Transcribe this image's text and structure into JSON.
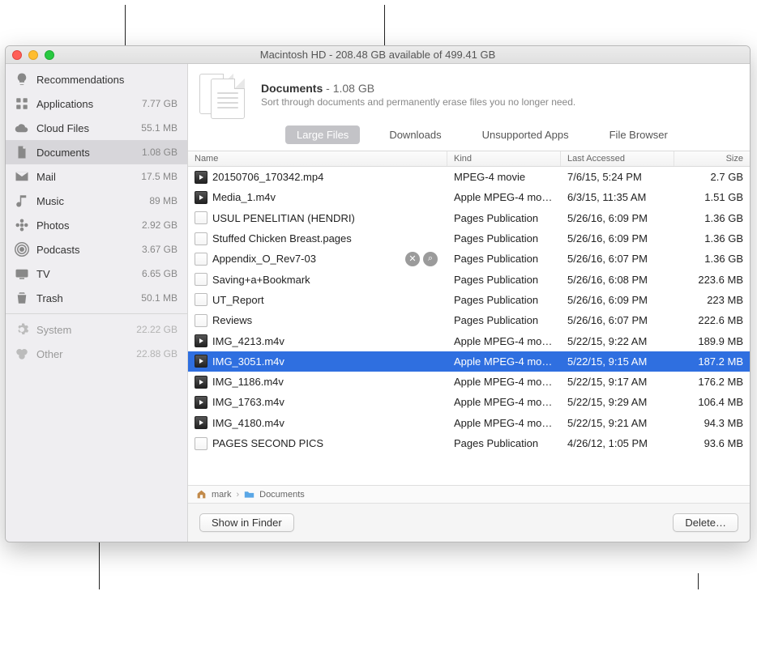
{
  "window": {
    "title": "Macintosh HD - 208.48 GB available of 499.41 GB"
  },
  "sidebar": {
    "items": [
      {
        "label": "Recommendations",
        "size": "",
        "icon": "lightbulb",
        "dim": false,
        "selected": false
      },
      {
        "label": "Applications",
        "size": "7.77 GB",
        "icon": "app-grid",
        "dim": false,
        "selected": false
      },
      {
        "label": "Cloud Files",
        "size": "55.1 MB",
        "icon": "cloud",
        "dim": false,
        "selected": false
      },
      {
        "label": "Documents",
        "size": "1.08 GB",
        "icon": "document",
        "dim": false,
        "selected": true
      },
      {
        "label": "Mail",
        "size": "17.5 MB",
        "icon": "envelope",
        "dim": false,
        "selected": false
      },
      {
        "label": "Music",
        "size": "89 MB",
        "icon": "music-note",
        "dim": false,
        "selected": false
      },
      {
        "label": "Photos",
        "size": "2.92 GB",
        "icon": "flower",
        "dim": false,
        "selected": false
      },
      {
        "label": "Podcasts",
        "size": "3.67 GB",
        "icon": "podcast",
        "dim": false,
        "selected": false
      },
      {
        "label": "TV",
        "size": "6.65 GB",
        "icon": "tv",
        "dim": false,
        "selected": false
      },
      {
        "label": "Trash",
        "size": "50.1 MB",
        "icon": "trash",
        "dim": false,
        "selected": false
      },
      {
        "label": "System",
        "size": "22.22 GB",
        "icon": "gear",
        "dim": true,
        "selected": false,
        "sepBefore": true
      },
      {
        "label": "Other",
        "size": "22.88 GB",
        "icon": "circles",
        "dim": true,
        "selected": false
      }
    ]
  },
  "header": {
    "title": "Documents",
    "size": "1.08 GB",
    "separator": " - ",
    "description": "Sort through documents and permanently erase files you no longer need."
  },
  "tabs": [
    {
      "label": "Large Files",
      "active": true
    },
    {
      "label": "Downloads",
      "active": false
    },
    {
      "label": "Unsupported Apps",
      "active": false
    },
    {
      "label": "File Browser",
      "active": false
    }
  ],
  "columns": {
    "name": "Name",
    "kind": "Kind",
    "date": "Last Accessed",
    "size": "Size"
  },
  "rows": [
    {
      "name": "20150706_170342.mp4",
      "kind": "MPEG-4 movie",
      "date": "7/6/15, 5:24 PM",
      "size": "2.7 GB",
      "thumb": "video"
    },
    {
      "name": "Media_1.m4v",
      "kind": "Apple MPEG-4 mo…",
      "date": "6/3/15, 11:35 AM",
      "size": "1.51 GB",
      "thumb": "video"
    },
    {
      "name": "USUL PENELITIAN (HENDRI)",
      "kind": "Pages Publication",
      "date": "5/26/16, 6:09 PM",
      "size": "1.36 GB",
      "thumb": "pages"
    },
    {
      "name": "Stuffed Chicken Breast.pages",
      "kind": "Pages Publication",
      "date": "5/26/16, 6:09 PM",
      "size": "1.36 GB",
      "thumb": "pages"
    },
    {
      "name": "Appendix_O_Rev7-03",
      "kind": "Pages Publication",
      "date": "5/26/16, 6:07 PM",
      "size": "1.36 GB",
      "thumb": "pages",
      "hover": true
    },
    {
      "name": "Saving+a+Bookmark",
      "kind": "Pages Publication",
      "date": "5/26/16, 6:08 PM",
      "size": "223.6 MB",
      "thumb": "pages"
    },
    {
      "name": "UT_Report",
      "kind": "Pages Publication",
      "date": "5/26/16, 6:09 PM",
      "size": "223 MB",
      "thumb": "pages"
    },
    {
      "name": "Reviews",
      "kind": "Pages Publication",
      "date": "5/26/16, 6:07 PM",
      "size": "222.6 MB",
      "thumb": "pages"
    },
    {
      "name": "IMG_4213.m4v",
      "kind": "Apple MPEG-4 mo…",
      "date": "5/22/15, 9:22 AM",
      "size": "189.9 MB",
      "thumb": "video"
    },
    {
      "name": "IMG_3051.m4v",
      "kind": "Apple MPEG-4 mo…",
      "date": "5/22/15, 9:15 AM",
      "size": "187.2 MB",
      "thumb": "video",
      "selected": true
    },
    {
      "name": "IMG_1186.m4v",
      "kind": "Apple MPEG-4 mo…",
      "date": "5/22/15, 9:17 AM",
      "size": "176.2 MB",
      "thumb": "video"
    },
    {
      "name": "IMG_1763.m4v",
      "kind": "Apple MPEG-4 mo…",
      "date": "5/22/15, 9:29 AM",
      "size": "106.4 MB",
      "thumb": "video"
    },
    {
      "name": "IMG_4180.m4v",
      "kind": "Apple MPEG-4 mo…",
      "date": "5/22/15, 9:21 AM",
      "size": "94.3 MB",
      "thumb": "video"
    },
    {
      "name": "PAGES SECOND PICS",
      "kind": "Pages Publication",
      "date": "4/26/12, 1:05 PM",
      "size": "93.6 MB",
      "thumb": "pages"
    }
  ],
  "path": {
    "user": "mark",
    "folder": "Documents"
  },
  "footer": {
    "show_in_finder": "Show in Finder",
    "delete": "Delete…"
  }
}
